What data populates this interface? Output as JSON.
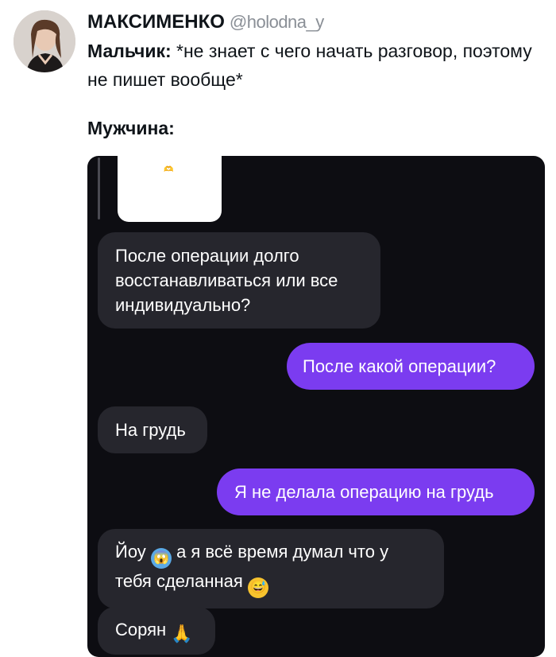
{
  "tweet": {
    "author_name": "МАКСИМЕНКО",
    "author_handle": "@holodna_y",
    "line1_bold": "Мальчик:",
    "line1_text": " *не знает с чего начать разговор, поэтому не пишет вообще*",
    "label2": "Мужчина:"
  },
  "chat": {
    "photo_sticker": "🫶",
    "messages": [
      {
        "side": "in",
        "text": "После операции долго восстанавливаться или все индивидуально?"
      },
      {
        "side": "out",
        "text": "После какой операции?"
      },
      {
        "side": "in",
        "text": "На грудь"
      },
      {
        "side": "out",
        "text": "Я не делала операцию на грудь"
      },
      {
        "side": "in",
        "text_a": "Йоу",
        "emoji_a": "😱",
        "text_b": " а я всё время думал что у тебя сделанная",
        "emoji_b": "😅"
      },
      {
        "side": "in",
        "text_a": "Сорян",
        "emoji_a": "🙏"
      }
    ]
  },
  "colors": {
    "outgoing": "#7b3cf0",
    "incoming": "#26262d",
    "chat_bg": "#0d0d12"
  }
}
